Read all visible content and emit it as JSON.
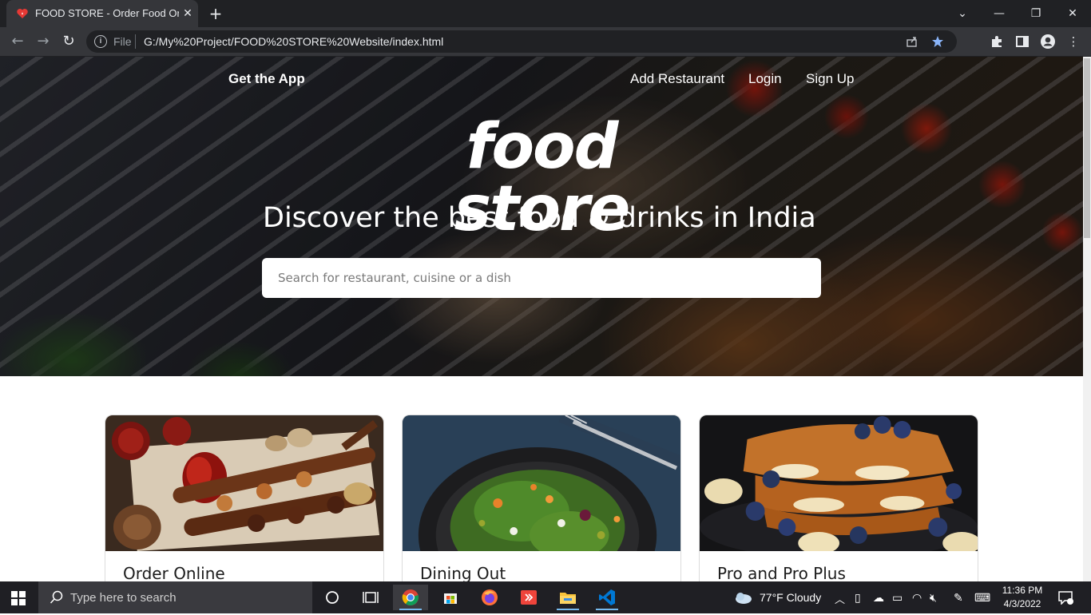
{
  "browser": {
    "tab_title": "FOOD STORE - Order Food Onlin",
    "tab_close": "✕",
    "new_tab": "+",
    "url_scheme": "File",
    "url": "G:/My%20Project/FOOD%20STORE%20Website/index.html",
    "window": {
      "minimize": "—",
      "restore": "❐",
      "close": "✕",
      "tablist": "⌄"
    }
  },
  "page": {
    "nav": {
      "get_app": "Get the App",
      "add_restaurant": "Add Restaurant",
      "login": "Login",
      "signup": "Sign Up"
    },
    "logo": "food store",
    "tagline": "Discover the best food & drinks in India",
    "search_placeholder": "Search for restaurant, cuisine or a dish",
    "cards": [
      {
        "label": "Order Online"
      },
      {
        "label": "Dining Out"
      },
      {
        "label": "Pro and Pro Plus"
      }
    ]
  },
  "taskbar": {
    "search_placeholder": "Type here to search",
    "weather": "77°F  Cloudy",
    "time": "11:36 PM",
    "date": "4/3/2022"
  },
  "colors": {
    "hero_text": "#ffffff",
    "card_label": "#1c1c1c",
    "chrome_dark": "#202124",
    "chrome_mid": "#35363a",
    "taskbar": "#1f1f24",
    "bookmark_star": "#8ab4f8"
  }
}
